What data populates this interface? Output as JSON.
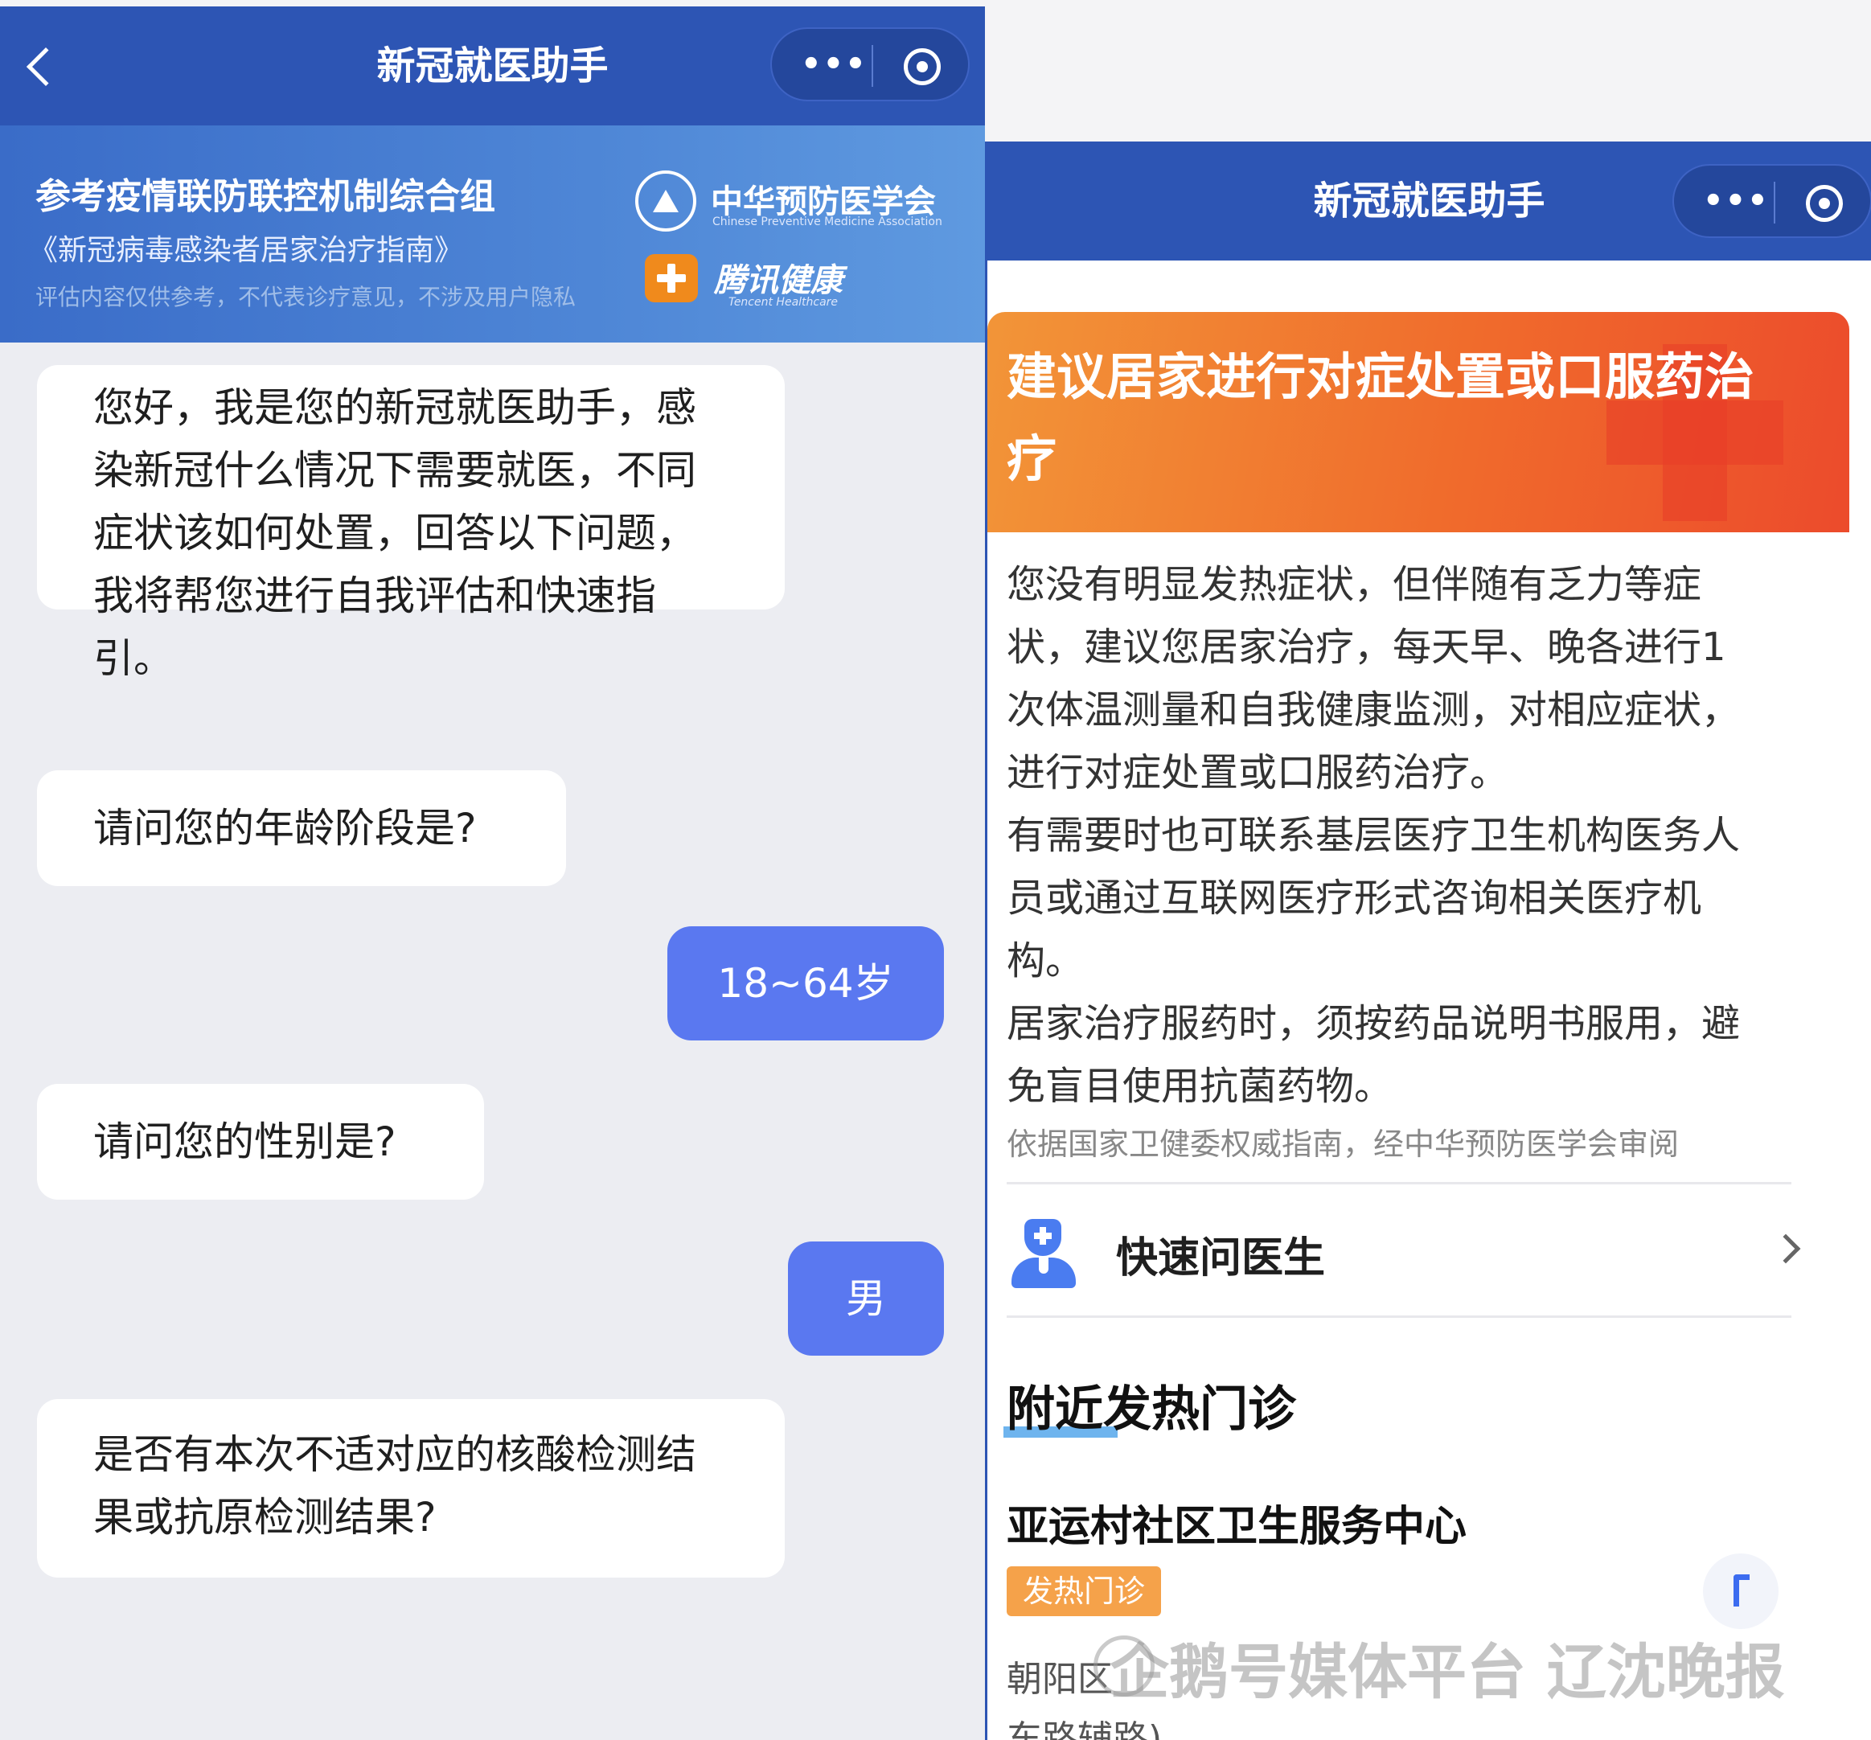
{
  "left": {
    "nav_title": "新冠就医助手",
    "banner": {
      "line1": "参考疫情联防联控机制综合组",
      "line2": "《新冠病毒感染者居家治疗指南》",
      "line3": "评估内容仅供参考，不代表诊疗意见，不涉及用户隐私",
      "logo1_title": "中华预防医学会",
      "logo1_sub": "Chinese Preventive Medicine Association",
      "logo2_title": "腾讯健康",
      "logo2_sub": "Tencent Healthcare"
    },
    "messages": [
      {
        "from": "bot",
        "lines": [
          "您好，我是您的新冠就医助手，感",
          "染新冠什么情况下需要就医，不同",
          "症状该如何处置，回答以下问题，",
          "我将帮您进行自我评估和快速指",
          "引。"
        ]
      },
      {
        "from": "bot",
        "text": "请问您的年龄阶段是?"
      },
      {
        "from": "user",
        "text": "18~64岁"
      },
      {
        "from": "bot",
        "text": "请问您的性别是?"
      },
      {
        "from": "user",
        "text": "男"
      },
      {
        "from": "bot",
        "lines": [
          "是否有本次不适对应的核酸检测结",
          "果或抗原检测结果?"
        ]
      }
    ]
  },
  "right": {
    "nav_title": "新冠就医助手",
    "result_title": "建议居家进行对症处置或口服药治疗",
    "body_lines": [
      "您没有明显发热症状，但伴随有乏力等症",
      "状，建议您居家治疗，每天早、晚各进行1",
      "次体温测量和自我健康监测，对相应症状，",
      "进行对症处置或口服药治疗。",
      "有需要时也可联系基层医疗卫生机构医务人",
      "员或通过互联网医疗形式咨询相关医疗机",
      "构。",
      "居家治疗服药时，须按药品说明书服用，避",
      "免盲目使用抗菌药物。"
    ],
    "note": "依据国家卫健委权威指南，经中华预防医学会审阅",
    "ask_doctor": "快速问医生",
    "nearby_title": "附近发热门诊",
    "clinic_name": "亚运村社区卫生服务中心",
    "clinic_tag": "发热门诊",
    "address_lines": [
      "朝阳区",
      "东路辅路)"
    ]
  },
  "watermark": "企鹅号媒体平台 辽沈晚报",
  "colors": {
    "nav_blue": "#2d55b4",
    "user_bubble": "#5a78f0",
    "header_orange": "#f06b2c",
    "tag_orange": "#f5a24a"
  }
}
